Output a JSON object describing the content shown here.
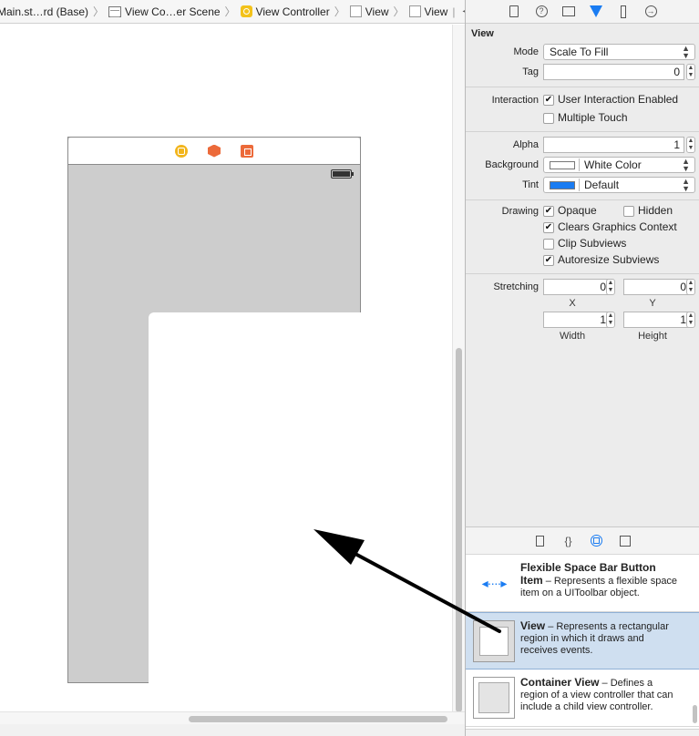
{
  "breadcrumb": {
    "items": [
      {
        "label": "Main.st…rd (Base)",
        "icon": "none"
      },
      {
        "label": "View Co…er Scene",
        "icon": "storyboard-icon"
      },
      {
        "label": "View Controller",
        "icon": "view-controller-icon"
      },
      {
        "label": "View",
        "icon": "view-icon"
      },
      {
        "label": "View",
        "icon": "view-icon"
      }
    ]
  },
  "inspector": {
    "section_title": "View",
    "mode": {
      "label": "Mode",
      "value": "Scale To Fill"
    },
    "tag": {
      "label": "Tag",
      "value": "0"
    },
    "interaction": {
      "label": "Interaction",
      "options": [
        {
          "label": "User Interaction Enabled",
          "checked": true
        },
        {
          "label": "Multiple Touch",
          "checked": false
        }
      ]
    },
    "alpha": {
      "label": "Alpha",
      "value": "1"
    },
    "background": {
      "label": "Background",
      "value": "White Color",
      "swatch": "#ffffff"
    },
    "tint": {
      "label": "Tint",
      "value": "Default",
      "swatch": "#1a7cf2"
    },
    "drawing": {
      "label": "Drawing",
      "opaque": {
        "label": "Opaque",
        "checked": true
      },
      "hidden": {
        "label": "Hidden",
        "checked": false
      },
      "clears": {
        "label": "Clears Graphics Context",
        "checked": true
      },
      "clip": {
        "label": "Clip Subviews",
        "checked": false
      },
      "autoresize": {
        "label": "Autoresize Subviews",
        "checked": true
      }
    },
    "stretching": {
      "label": "Stretching",
      "x": {
        "value": "0",
        "label": "X"
      },
      "y": {
        "value": "0",
        "label": "Y"
      },
      "width": {
        "value": "1",
        "label": "Width"
      },
      "height": {
        "value": "1",
        "label": "Height"
      }
    }
  },
  "library": {
    "items": [
      {
        "title": "Flexible Space Bar Button Item",
        "desc": " – Represents a flexible space item on a UIToolbar object.",
        "icon": "flexible-space-icon"
      },
      {
        "title": "View",
        "desc": " – Represents a rectangular region in which it draws and receives events.",
        "icon": "view-object-icon",
        "selected": true
      },
      {
        "title": "Container View",
        "desc": " – Defines a region of a view controller that can include a child view controller.",
        "icon": "container-view-icon"
      }
    ]
  },
  "colors": {
    "accent": "#1a7cf2",
    "scene_background": "#cdcdcd",
    "selection": "#cfdff0"
  }
}
